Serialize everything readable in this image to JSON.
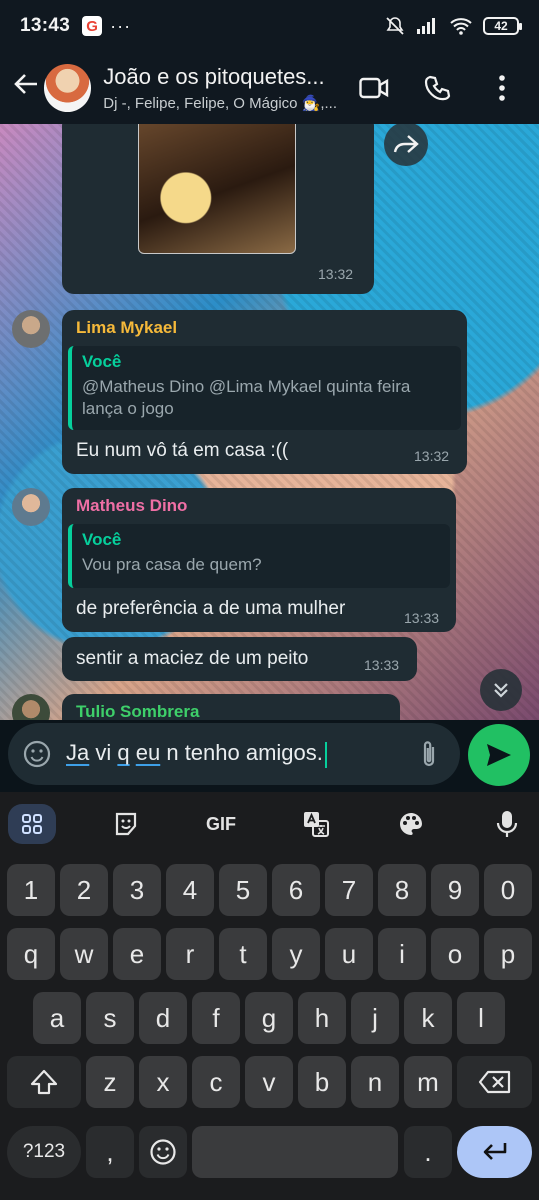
{
  "status_bar": {
    "time": "13:43",
    "google_icon": "G",
    "more": "···",
    "battery": "42"
  },
  "header": {
    "title": "João e os pitoquetes...",
    "subtitle": "Dj -, Felipe, Felipe, O Mágico 🧙‍♂️,..."
  },
  "messages": [
    {
      "type": "image",
      "time": "13:32"
    },
    {
      "sender": "Lima Mykael",
      "sender_color": "#f5b93a",
      "quote_name": "Você",
      "quote_text": "@Matheus Dino @Lima Mykael quinta feira lança o jogo",
      "text": "Eu num vô tá em casa :((",
      "time": "13:32"
    },
    {
      "sender": "Matheus Dino",
      "sender_color": "#ef6fa5",
      "quote_name": "Você",
      "quote_text": "Vou pra casa de quem?",
      "text": "de preferência a de uma mulher",
      "time": "13:33"
    },
    {
      "text": "sentir a maciez de um peito",
      "time": "13:33"
    },
    {
      "sender": "Tulio Sombrera",
      "sender_color": "#3ecf6a"
    }
  ],
  "composer": {
    "draft_underlined_1": "Ja",
    "draft_plain_1": " vi ",
    "draft_underlined_2": "q",
    "draft_plain_2": " ",
    "draft_underlined_3": "eu",
    "draft_plain_3": " n tenho amigos."
  },
  "keyboard": {
    "toolbar": {
      "gif": "GIF"
    },
    "row_numbers": [
      "1",
      "2",
      "3",
      "4",
      "5",
      "6",
      "7",
      "8",
      "9",
      "0"
    ],
    "row1": [
      "q",
      "w",
      "e",
      "r",
      "t",
      "y",
      "u",
      "i",
      "o",
      "p"
    ],
    "row2": [
      "a",
      "s",
      "d",
      "f",
      "g",
      "h",
      "j",
      "k",
      "l"
    ],
    "row3": [
      "z",
      "x",
      "c",
      "v",
      "b",
      "n",
      "m"
    ],
    "symbols": "?123",
    "comma": ",",
    "period": "."
  }
}
